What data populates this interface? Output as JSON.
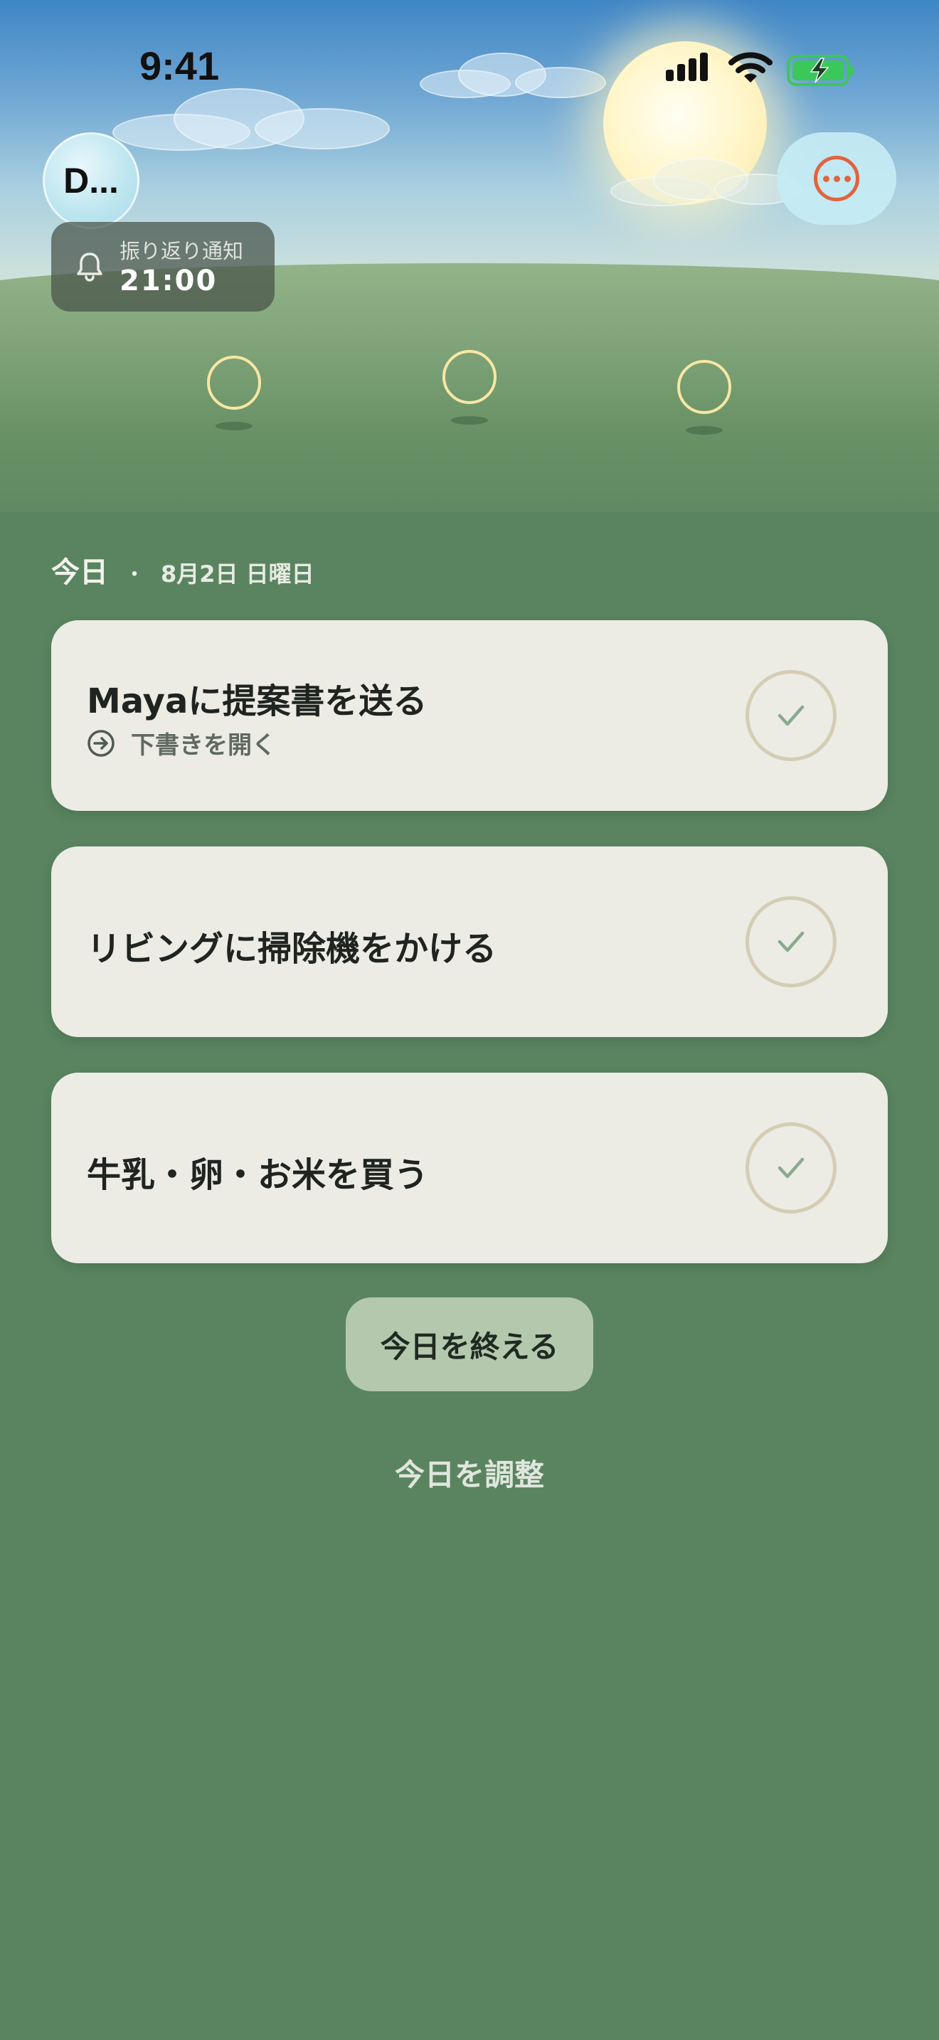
{
  "status_bar": {
    "time": "9:41",
    "icons": [
      "cellular-signal-icon",
      "wifi-icon",
      "battery-charging-icon"
    ],
    "battery_color": "#3cc75b"
  },
  "header": {
    "avatar_initial": "D...",
    "more_icon": "ellipsis-circle-icon",
    "accent_color": "#e0643f"
  },
  "reminder": {
    "label": "振り返り通知",
    "time": "21:00",
    "icon": "bell-icon"
  },
  "today": {
    "title": "今日",
    "separator": "・",
    "date": "8月2日 日曜日"
  },
  "tasks": [
    {
      "title": "Mayaに提案書を送る",
      "subtitle": "下書きを開く",
      "subtitle_icon": "arrow-right-circle-icon",
      "done": false
    },
    {
      "title": "リビングに掃除機をかける",
      "done": false
    },
    {
      "title": "牛乳・卵・お米を買う",
      "done": false
    }
  ],
  "actions": {
    "end_day": "今日を終える",
    "adjust_day": "今日を調整"
  },
  "colors": {
    "background": "#5a8460",
    "card": "#ecebe4",
    "end_button": "#b4c8ae",
    "check_ring": "#d4cdb4",
    "check_mark": "#8aaa8f"
  }
}
